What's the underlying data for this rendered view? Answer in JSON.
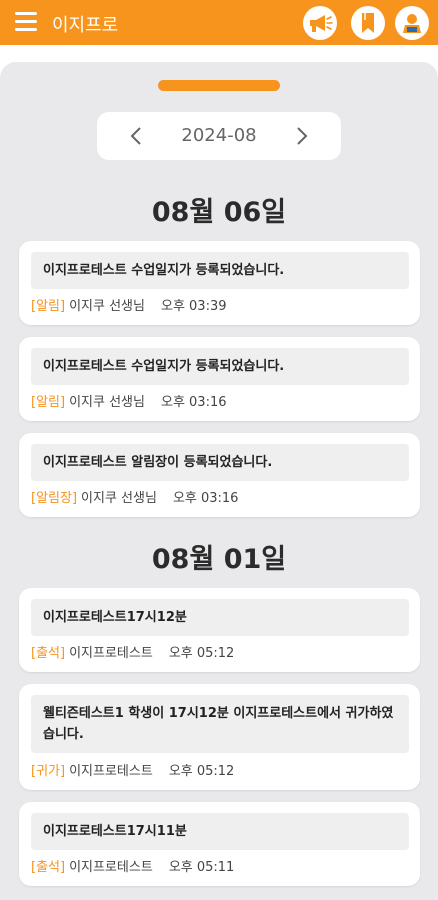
{
  "app": {
    "title": "이지프로"
  },
  "icons": {
    "menu": "hamburger-icon",
    "announce": "megaphone-icon",
    "bookmark": "bookmark-icon",
    "user": "user-icon"
  },
  "colors": {
    "accent": "#f7941d",
    "background": "#e9e9ec"
  },
  "month_nav": {
    "current": "2024-08",
    "prev": "‹",
    "next": "›"
  },
  "groups": [
    {
      "date": "08월 06일",
      "items": [
        {
          "message": "이지프로테스트 수업일지가 등록되었습니다.",
          "tag": "[알림]",
          "sender": "이지쿠 선생님",
          "time": "오후 03:39"
        },
        {
          "message": "이지프로테스트 수업일지가 등록되었습니다.",
          "tag": "[알림]",
          "sender": "이지쿠 선생님",
          "time": "오후 03:16"
        },
        {
          "message": "이지프로테스트 알림장이 등록되었습니다.",
          "tag": "[알림장]",
          "sender": "이지쿠 선생님",
          "time": "오후 03:16"
        }
      ]
    },
    {
      "date": "08월 01일",
      "items": [
        {
          "message": "이지프로테스트17시12분",
          "tag": "[출석]",
          "sender": "이지프로테스트",
          "time": "오후 05:12"
        },
        {
          "message": "웰티즌테스트1 학생이 17시12분 이지프로테스트에서 귀가하였습니다.",
          "tag": "[귀가]",
          "sender": "이지프로테스트",
          "time": "오후 05:12"
        },
        {
          "message": "이지프로테스트17시11분",
          "tag": "[출석]",
          "sender": "이지프로테스트",
          "time": "오후 05:11"
        }
      ]
    }
  ]
}
